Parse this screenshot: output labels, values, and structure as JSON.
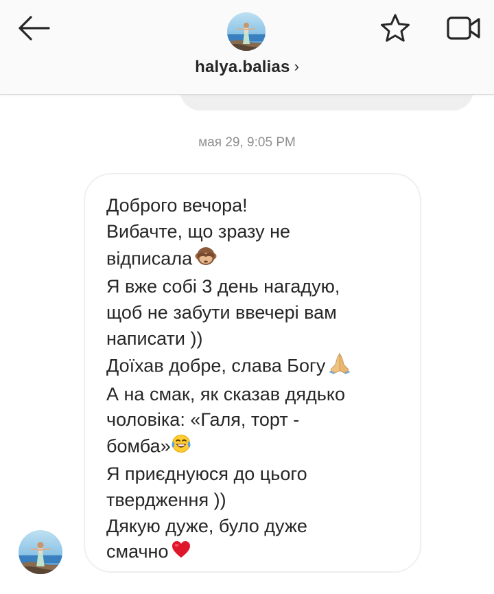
{
  "header": {
    "username": "halya.balias",
    "chevron": "›",
    "back_icon": "arrow-left-icon",
    "star_icon": "star-outline-icon",
    "video_icon": "video-camera-icon",
    "avatar_icon": "profile-photo"
  },
  "thread": {
    "timestamp": "мая 29, 9:05 PM",
    "message": {
      "lines": [
        "Доброго вечора!",
        "Вибачте, що зразу не",
        "відписала",
        "Я вже собі 3 день нагадую,",
        "щоб не забути ввечері вам",
        "написати ))",
        "Доїхав добре, слава Богу",
        "А на смак, як сказав дядько",
        "чоловіка: «Галя, торт -",
        "бомба»",
        "Я приєднуюся до цього",
        "твердження ))",
        "Дякую дуже, було дуже",
        "смачно"
      ],
      "emojis": {
        "see_no_evil": "see-no-evil-monkey-emoji",
        "pray": "folded-hands-emoji",
        "laugh": "tears-of-joy-emoji",
        "heart": "red-heart-emoji"
      }
    }
  },
  "colors": {
    "header_bg": "#fafafa",
    "text": "#262626",
    "muted": "#8e8e8e",
    "bubble_border": "#efefef",
    "heart": "#e0162b"
  }
}
